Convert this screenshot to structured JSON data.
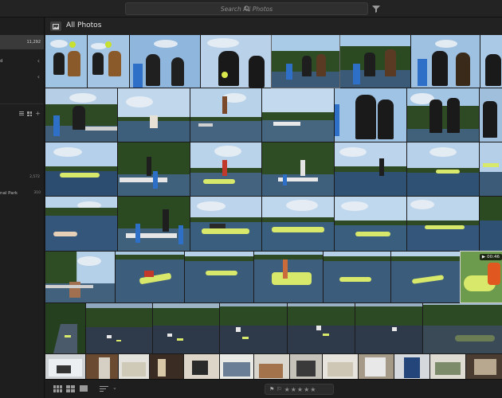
{
  "search": {
    "placeholder": "Search All Photos"
  },
  "left_panel": {
    "all_photos_count": "11,292",
    "row2_count": "2,572",
    "park_label": "nal Park",
    "park_count": "310"
  },
  "main": {
    "title": "All Photos"
  },
  "video_badge": {
    "duration": "00:46"
  },
  "bottom": {
    "stars": "★★★★★"
  },
  "colors": {
    "sky": "#a8c8e6",
    "lake": "#3a5a78",
    "trees": "#2f4d25",
    "float": "#d8e86a",
    "accent": "#2e6fc8"
  }
}
